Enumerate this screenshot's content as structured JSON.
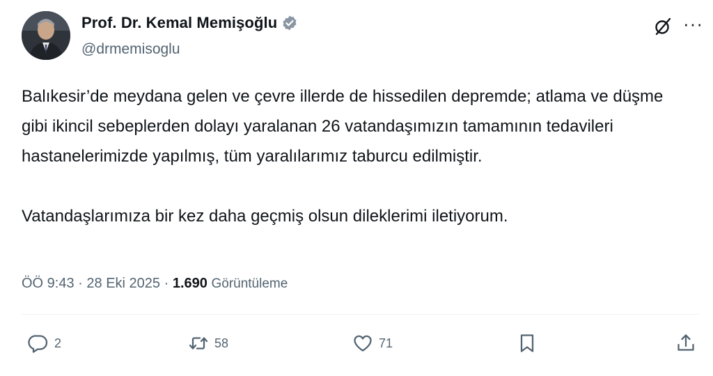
{
  "author": {
    "display_name": "Prof. Dr. Kemal Memişoğlu",
    "handle": "@drmemisoglu",
    "verified": true,
    "verified_color": "#8a96a3"
  },
  "tweet": {
    "paragraphs": [
      "Balıkesir’de meydana gelen ve çevre illerde de hissedilen depremde; atlama ve düşme gibi ikincil sebeplerden dolayı yaralanan 26 vatandaşımızın tamamının tedavileri hastanelerimizde yapılmış, tüm yaralılarımız taburcu edilmiştir.",
      "Vatandaşlarımıza bir kez daha geçmiş olsun dileklerimi iletiyorum."
    ]
  },
  "meta": {
    "time": "ÖÖ 9:43",
    "separator": "·",
    "date": "28 Eki 2025",
    "views_count": "1.690",
    "views_label": "Görüntüleme"
  },
  "actions": {
    "reply_count": "2",
    "retweet_count": "58",
    "like_count": "71"
  },
  "icons": {
    "header": [
      "grok-icon",
      "more-options-icon"
    ],
    "actions": [
      "reply-icon",
      "retweet-icon",
      "like-icon",
      "bookmark-icon",
      "share-icon"
    ]
  }
}
